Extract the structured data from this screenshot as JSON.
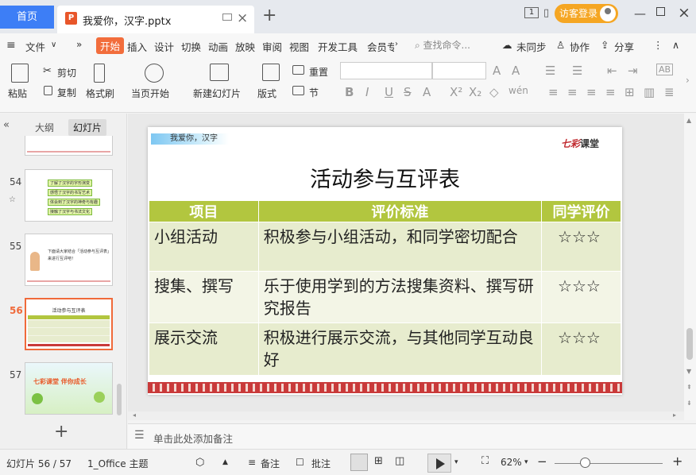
{
  "titlebar": {
    "home_tab": "首页",
    "doc_tab": "我爱你，汉字.pptx",
    "visitor_login": "访客登录",
    "new_tab": "+",
    "page_indicator": "1"
  },
  "menubar": {
    "file": "文件",
    "items": [
      "开始",
      "插入",
      "设计",
      "切换",
      "动画",
      "放映",
      "审阅",
      "视图",
      "开发工具",
      "会员专"
    ],
    "search_placeholder": "查找命令...",
    "sync": "未同步",
    "collab": "协作",
    "share": "分享"
  },
  "toolbar": {
    "paste": "粘贴",
    "cut": "剪切",
    "copy": "复制",
    "format_painter": "格式刷",
    "play_from_current": "当页开始",
    "new_slide": "新建幻灯片",
    "layout": "版式",
    "reset": "重置",
    "section": "节"
  },
  "leftpanel": {
    "outline_tab": "大纲",
    "slides_tab": "幻灯片",
    "slide_numbers": [
      "54",
      "55",
      "56",
      "57"
    ],
    "thumb54_lines": [
      "了解了汉字的字形演变",
      "感悟了汉字的书写艺术",
      "体会到了汉字的神奇与有趣",
      "接触了汉字与书法文化"
    ],
    "thumb55_text": "下面请大家结合「活动参与互评表」来进行互评吧！",
    "thumb56_title": "活动参与互评表",
    "thumb57_text": "七彩课堂  伴你成长",
    "add_slide": "+"
  },
  "slide": {
    "tag": "我爱你，汉字",
    "logo_a": "七彩",
    "logo_b": "课堂",
    "title": "活动参与互评表",
    "headers": [
      "项目",
      "评价标准",
      "同学评价"
    ],
    "rows": [
      {
        "item": "小组活动",
        "criteria": "积极参与小组活动，和同学密切配合",
        "rating": "☆☆☆"
      },
      {
        "item": "搜集、撰写",
        "criteria": "乐于使用学到的方法搜集资料、撰写研究报告",
        "rating": "☆☆☆"
      },
      {
        "item": "展示交流",
        "criteria": "积极进行展示交流，与其他同学互动良好",
        "rating": "☆☆☆"
      }
    ]
  },
  "notes": {
    "placeholder": "单击此处添加备注"
  },
  "statusbar": {
    "slide_counter": "幻灯片 56 / 57",
    "theme": "1_Office 主题",
    "notes": "备注",
    "comments": "批注",
    "zoom": "62%",
    "zoom_out": "−",
    "zoom_in": "+"
  },
  "colors": {
    "accent": "#f26d3c",
    "home_tab": "#3d7ef6",
    "visitor": "#f5a623",
    "table_header": "#b2c63f"
  }
}
